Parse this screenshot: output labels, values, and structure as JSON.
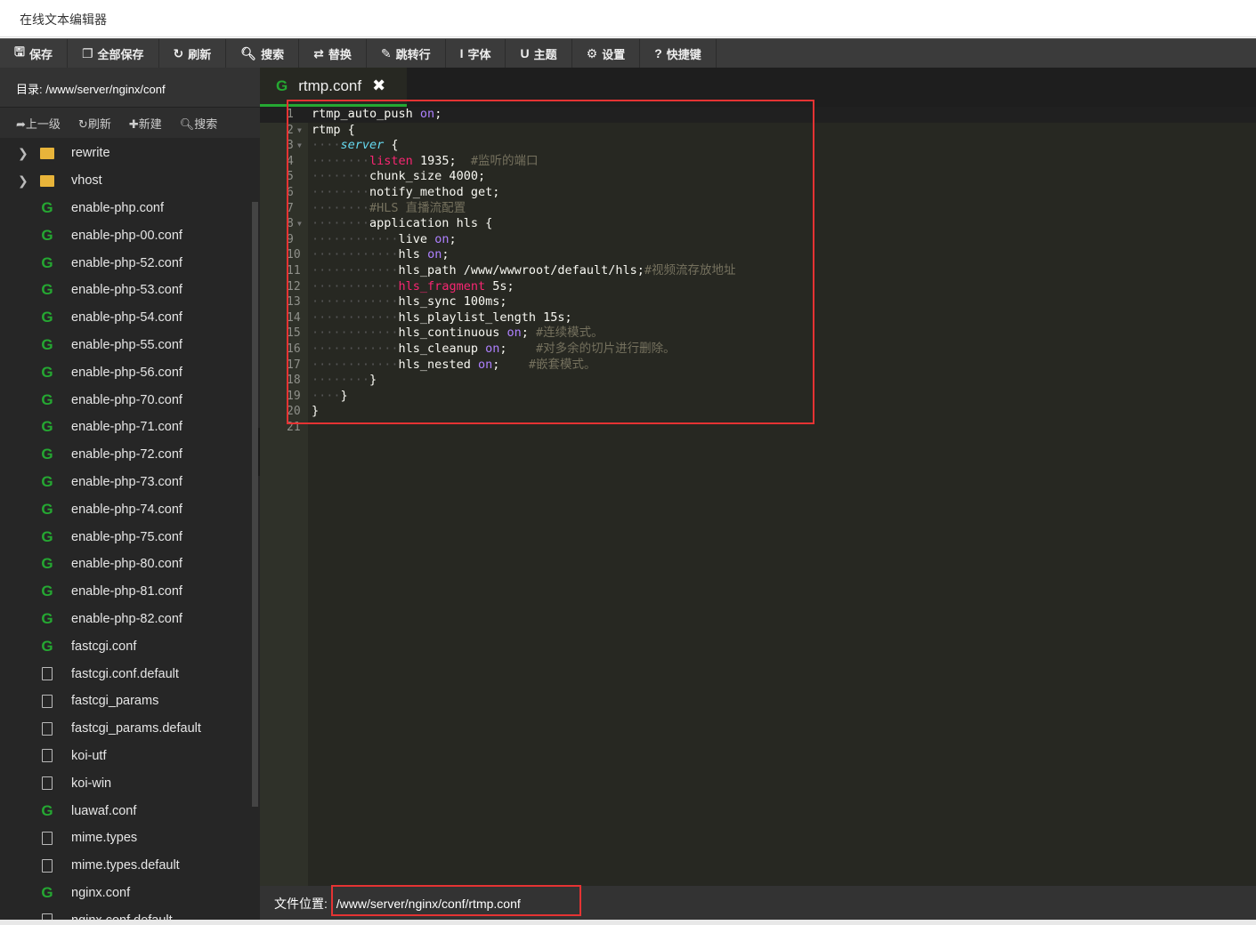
{
  "app": {
    "title": "在线文本编辑器"
  },
  "toolbar": [
    {
      "icon": "save-icon",
      "glyph": "🖫",
      "label": "保存"
    },
    {
      "icon": "save-all-icon",
      "glyph": "❐",
      "label": "全部保存"
    },
    {
      "icon": "refresh-icon",
      "glyph": "↻",
      "label": "刷新"
    },
    {
      "icon": "search-icon",
      "glyph": "🔍︎",
      "label": "搜索"
    },
    {
      "icon": "replace-icon",
      "glyph": "⇄",
      "label": "替换"
    },
    {
      "icon": "pin-icon",
      "glyph": "✎",
      "label": "跳转行"
    },
    {
      "icon": "font-icon",
      "glyph": "I",
      "label": "字体"
    },
    {
      "icon": "theme-icon",
      "glyph": "U",
      "label": "主题"
    },
    {
      "icon": "gear-icon",
      "glyph": "⚙",
      "label": "设置"
    },
    {
      "icon": "help-icon",
      "glyph": "?",
      "label": "快捷键"
    }
  ],
  "sidebar": {
    "dir_label": "目录: /www/server/nginx/conf",
    "tools": [
      {
        "glyph": "➦",
        "label": "上一级"
      },
      {
        "glyph": "↻",
        "label": "刷新"
      },
      {
        "glyph": "✚",
        "label": "新建"
      },
      {
        "glyph": "🔍︎",
        "label": "搜索"
      }
    ],
    "files": [
      {
        "name": "rewrite",
        "type": "folder"
      },
      {
        "name": "vhost",
        "type": "folder"
      },
      {
        "name": "enable-php.conf",
        "type": "conf"
      },
      {
        "name": "enable-php-00.conf",
        "type": "conf"
      },
      {
        "name": "enable-php-52.conf",
        "type": "conf"
      },
      {
        "name": "enable-php-53.conf",
        "type": "conf"
      },
      {
        "name": "enable-php-54.conf",
        "type": "conf"
      },
      {
        "name": "enable-php-55.conf",
        "type": "conf"
      },
      {
        "name": "enable-php-56.conf",
        "type": "conf"
      },
      {
        "name": "enable-php-70.conf",
        "type": "conf"
      },
      {
        "name": "enable-php-71.conf",
        "type": "conf"
      },
      {
        "name": "enable-php-72.conf",
        "type": "conf"
      },
      {
        "name": "enable-php-73.conf",
        "type": "conf"
      },
      {
        "name": "enable-php-74.conf",
        "type": "conf"
      },
      {
        "name": "enable-php-75.conf",
        "type": "conf"
      },
      {
        "name": "enable-php-80.conf",
        "type": "conf"
      },
      {
        "name": "enable-php-81.conf",
        "type": "conf"
      },
      {
        "name": "enable-php-82.conf",
        "type": "conf"
      },
      {
        "name": "fastcgi.conf",
        "type": "conf"
      },
      {
        "name": "fastcgi.conf.default",
        "type": "text"
      },
      {
        "name": "fastcgi_params",
        "type": "text"
      },
      {
        "name": "fastcgi_params.default",
        "type": "text"
      },
      {
        "name": "koi-utf",
        "type": "text"
      },
      {
        "name": "koi-win",
        "type": "text"
      },
      {
        "name": "luawaf.conf",
        "type": "conf"
      },
      {
        "name": "mime.types",
        "type": "text"
      },
      {
        "name": "mime.types.default",
        "type": "text"
      },
      {
        "name": "nginx.conf",
        "type": "conf"
      },
      {
        "name": "nginx.conf.default",
        "type": "text"
      }
    ]
  },
  "editor": {
    "tab": {
      "label": "rtmp.conf",
      "close_glyph": "✖"
    },
    "lines": [
      {
        "indent": 0,
        "fold": false,
        "t": [
          [
            "",
            "rtmp_auto_push "
          ],
          [
            "pu",
            "on"
          ],
          [
            "",
            ";"
          ]
        ]
      },
      {
        "indent": 0,
        "fold": true,
        "t": [
          [
            "",
            "rtmp {  "
          ]
        ]
      },
      {
        "indent": 4,
        "fold": true,
        "t": [
          [
            "bl",
            "server"
          ],
          [
            "",
            " {  "
          ]
        ]
      },
      {
        "indent": 8,
        "t": [
          [
            "kw",
            "listen"
          ],
          [
            "",
            " 1935;  "
          ],
          [
            "cm",
            "#监听的端口"
          ]
        ]
      },
      {
        "indent": 8,
        "t": [
          [
            "",
            "chunk_size 4000;"
          ]
        ]
      },
      {
        "indent": 8,
        "t": [
          [
            "",
            "notify_method get;"
          ]
        ]
      },
      {
        "indent": 8,
        "t": [
          [
            "cm",
            "#HLS 直播流配置"
          ]
        ]
      },
      {
        "indent": 8,
        "fold": true,
        "t": [
          [
            "",
            "application hls {"
          ]
        ]
      },
      {
        "indent": 12,
        "t": [
          [
            "",
            "live "
          ],
          [
            "pu",
            "on"
          ],
          [
            "",
            ";"
          ]
        ]
      },
      {
        "indent": 12,
        "t": [
          [
            "",
            "hls "
          ],
          [
            "pu",
            "on"
          ],
          [
            "",
            ";"
          ]
        ]
      },
      {
        "indent": 12,
        "t": [
          [
            "",
            "hls_path /www/wwwroot/default/hls;"
          ],
          [
            "cm",
            "#视频流存放地址"
          ]
        ]
      },
      {
        "indent": 12,
        "t": [
          [
            "kw",
            "hls_fragment"
          ],
          [
            "",
            " 5s;"
          ]
        ]
      },
      {
        "indent": 12,
        "t": [
          [
            "",
            "hls_sync 100ms;"
          ]
        ]
      },
      {
        "indent": 12,
        "t": [
          [
            "",
            "hls_playlist_length 15s;"
          ]
        ]
      },
      {
        "indent": 12,
        "t": [
          [
            "",
            "hls_continuous "
          ],
          [
            "pu",
            "on"
          ],
          [
            "",
            "; "
          ],
          [
            "cm",
            "#连续模式。"
          ]
        ]
      },
      {
        "indent": 12,
        "t": [
          [
            "",
            "hls_cleanup "
          ],
          [
            "pu",
            "on"
          ],
          [
            "",
            ";    "
          ],
          [
            "cm",
            "#对多余的切片进行删除。"
          ]
        ]
      },
      {
        "indent": 12,
        "t": [
          [
            "",
            "hls_nested "
          ],
          [
            "pu",
            "on"
          ],
          [
            "",
            ";    "
          ],
          [
            "cm",
            "#嵌套模式。"
          ]
        ]
      },
      {
        "indent": 8,
        "t": [
          [
            "",
            "}"
          ]
        ]
      },
      {
        "indent": 4,
        "t": [
          [
            "",
            "}"
          ]
        ]
      },
      {
        "indent": 0,
        "t": [
          [
            "",
            "}"
          ]
        ]
      },
      {
        "indent": 0,
        "t": [
          [
            "",
            ""
          ]
        ]
      }
    ]
  },
  "footer": {
    "label": "文件位置:",
    "path": "/www/server/nginx/conf/rtmp.conf"
  },
  "colors": {
    "highlight_box": "#e53333",
    "accent": "#25a832"
  }
}
